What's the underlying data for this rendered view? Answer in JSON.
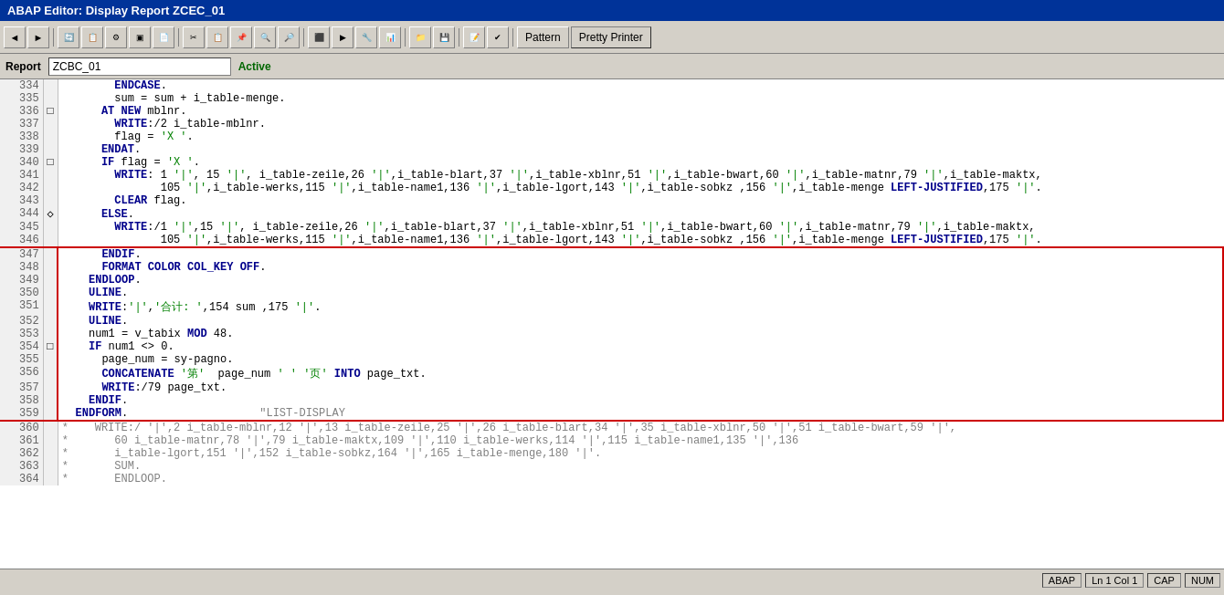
{
  "titleBar": {
    "text": "ABAP Editor: Display Report ZCEC_01"
  },
  "toolbar": {
    "buttons": [
      {
        "name": "back",
        "icon": "◄"
      },
      {
        "name": "forward",
        "icon": "►"
      },
      {
        "name": "save",
        "icon": "💾"
      },
      {
        "name": "find",
        "icon": "🔍"
      },
      {
        "name": "settings",
        "icon": "⚙"
      },
      {
        "name": "toggle",
        "icon": "▣"
      },
      {
        "name": "split",
        "icon": "⬜"
      },
      {
        "name": "new",
        "icon": "📄"
      },
      {
        "name": "open",
        "icon": "📂"
      },
      {
        "name": "print",
        "icon": "🖨"
      },
      {
        "name": "check",
        "icon": "✔"
      },
      {
        "name": "activate",
        "icon": "▶"
      },
      {
        "name": "test",
        "icon": "▷"
      }
    ],
    "patternLabel": "Pattern",
    "prettyPrinterLabel": "Pretty Printer"
  },
  "reportBar": {
    "label": "Report",
    "value": "ZCBC_01",
    "status": "Active"
  },
  "lines": [
    {
      "num": "334",
      "marker": "",
      "code": "        ENDCASE.",
      "highlight": false
    },
    {
      "num": "335",
      "marker": "",
      "code": "        sum = sum + i_table-menge.",
      "highlight": false
    },
    {
      "num": "336",
      "marker": "□",
      "code": "      AT NEW mblnr.",
      "highlight": false
    },
    {
      "num": "337",
      "marker": "",
      "code": "        WRITE:/2 i_table-mblnr.",
      "highlight": false
    },
    {
      "num": "338",
      "marker": "",
      "code": "        flag = 'X '.",
      "highlight": false
    },
    {
      "num": "339",
      "marker": "",
      "code": "      ENDAT.",
      "highlight": false
    },
    {
      "num": "340",
      "marker": "□",
      "code": "      IF flag = 'X '.",
      "highlight": false
    },
    {
      "num": "341",
      "marker": "",
      "code": "        WRITE: 1 '|', 15 '|', i_table-zeile,26 '|',i_table-blart,37 '|',i_table-xblnr,51 '|',i_table-bwart,60 '|',i_table-matnr,79 '|',i_table-maktx,",
      "highlight": false
    },
    {
      "num": "342",
      "marker": "",
      "code": "               105 '|',i_table-werks,115 '|',i_table-name1,136 '|',i_table-lgort,143 '|',i_table-sobkz ,156 '|',i_table-menge LEFT-JUSTIFIED,175 '|'.",
      "highlight": false
    },
    {
      "num": "343",
      "marker": "",
      "code": "        CLEAR flag.",
      "highlight": false
    },
    {
      "num": "344",
      "marker": "◇",
      "code": "      ELSE.",
      "highlight": false
    },
    {
      "num": "345",
      "marker": "",
      "code": "        WRITE:/1 '|',15 '|', i_table-zeile,26 '|',i_table-blart,37 '|',i_table-xblnr,51 '|',i_table-bwart,60 '|',i_table-matnr,79 '|',i_table-maktx,",
      "highlight": false
    },
    {
      "num": "346",
      "marker": "",
      "code": "               105 '|',i_table-werks,115 '|',i_table-name1,136 '|',i_table-lgort,143 '|',i_table-sobkz ,156 '|',i_table-menge LEFT-JUSTIFIED,175 '|'.",
      "highlight": false
    },
    {
      "num": "347",
      "marker": "",
      "code": "      ENDIF.",
      "highlight": true
    },
    {
      "num": "348",
      "marker": "",
      "code": "      FORMAT COLOR COL_KEY OFF.",
      "highlight": true
    },
    {
      "num": "349",
      "marker": "",
      "code": "    ENDLOOP.",
      "highlight": true
    },
    {
      "num": "350",
      "marker": "",
      "code": "    ULINE.",
      "highlight": true
    },
    {
      "num": "351",
      "marker": "",
      "code": "    WRITE:'|','合计: ',154 sum ,175 '|'.",
      "highlight": true
    },
    {
      "num": "352",
      "marker": "",
      "code": "    ULINE.",
      "highlight": true
    },
    {
      "num": "353",
      "marker": "",
      "code": "    num1 = v_tabix MOD 48.",
      "highlight": true
    },
    {
      "num": "354",
      "marker": "□",
      "code": "    IF num1 <> 0.",
      "highlight": true
    },
    {
      "num": "355",
      "marker": "",
      "code": "      page_num = sy-pagno.",
      "highlight": true
    },
    {
      "num": "356",
      "marker": "",
      "code": "      CONCATENATE '第'  page_num ' ' '页' INTO page_txt.",
      "highlight": true
    },
    {
      "num": "357",
      "marker": "",
      "code": "      WRITE:/79 page_txt.",
      "highlight": true
    },
    {
      "num": "358",
      "marker": "",
      "code": "    ENDIF.",
      "highlight": true
    },
    {
      "num": "359",
      "marker": "",
      "code": "  ENDFORM.                    \"LIST-DISPLAY",
      "highlight": true
    },
    {
      "num": "360",
      "marker": "",
      "code": "*    WRITE:/ '|',2 i_table-mblnr,12 '|',13 i_table-zeile,25 '|',26 i_table-blart,34 '|',35 i_table-xblnr,50 '|',51 i_table-bwart,59 '|',",
      "highlight": false,
      "isComment": true
    },
    {
      "num": "361",
      "marker": "",
      "code": "*       60 i_table-matnr,78 '|',79 i_table-maktx,109 '|',110 i_table-werks,114 '|',115 i_table-name1,135 '|',136",
      "highlight": false,
      "isComment": true
    },
    {
      "num": "362",
      "marker": "",
      "code": "*       i_table-lgort,151 '|',152 i_table-sobkz,164 '|',165 i_table-menge,180 '|'.",
      "highlight": false,
      "isComment": true
    },
    {
      "num": "363",
      "marker": "",
      "code": "*       SUM.",
      "highlight": false,
      "isComment": true
    },
    {
      "num": "364",
      "marker": "",
      "code": "*       ENDLOOP.",
      "highlight": false,
      "isComment": true
    }
  ],
  "statusBar": {
    "lang": "ABAP",
    "position": "Ln  1 Col  1",
    "cap": "CAP",
    "num": "NUM"
  }
}
